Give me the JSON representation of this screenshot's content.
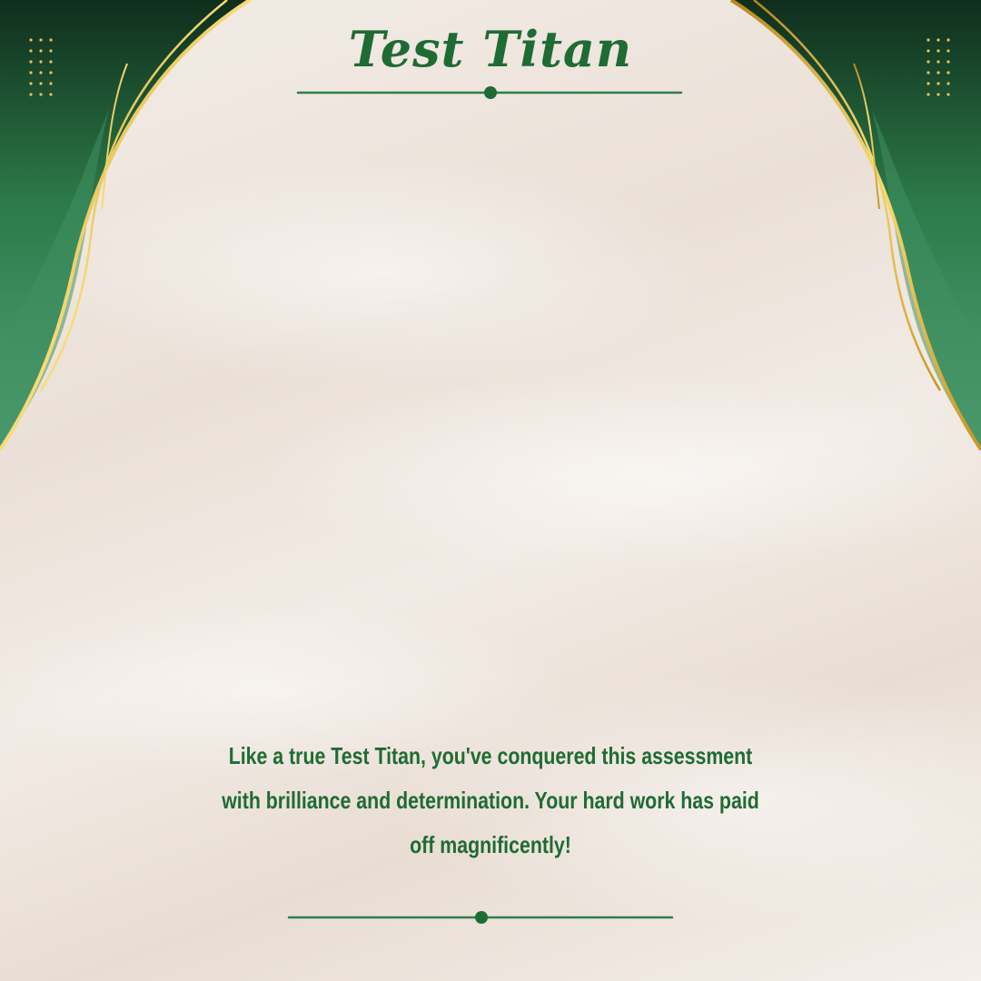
{
  "title": "Test Titan",
  "message": "Like a true Test Titan, you've conquered this assessment with brilliance and determination. Your hard work has paid off magnificently!",
  "colors": {
    "green_dark": "#123a22",
    "green_mid": "#2f7d4c",
    "green_light": "#4e9c72",
    "gold": "#d9a82a",
    "gold_light": "#f5d76b",
    "text_green": "#1f6b34",
    "background": "#efe7df"
  }
}
